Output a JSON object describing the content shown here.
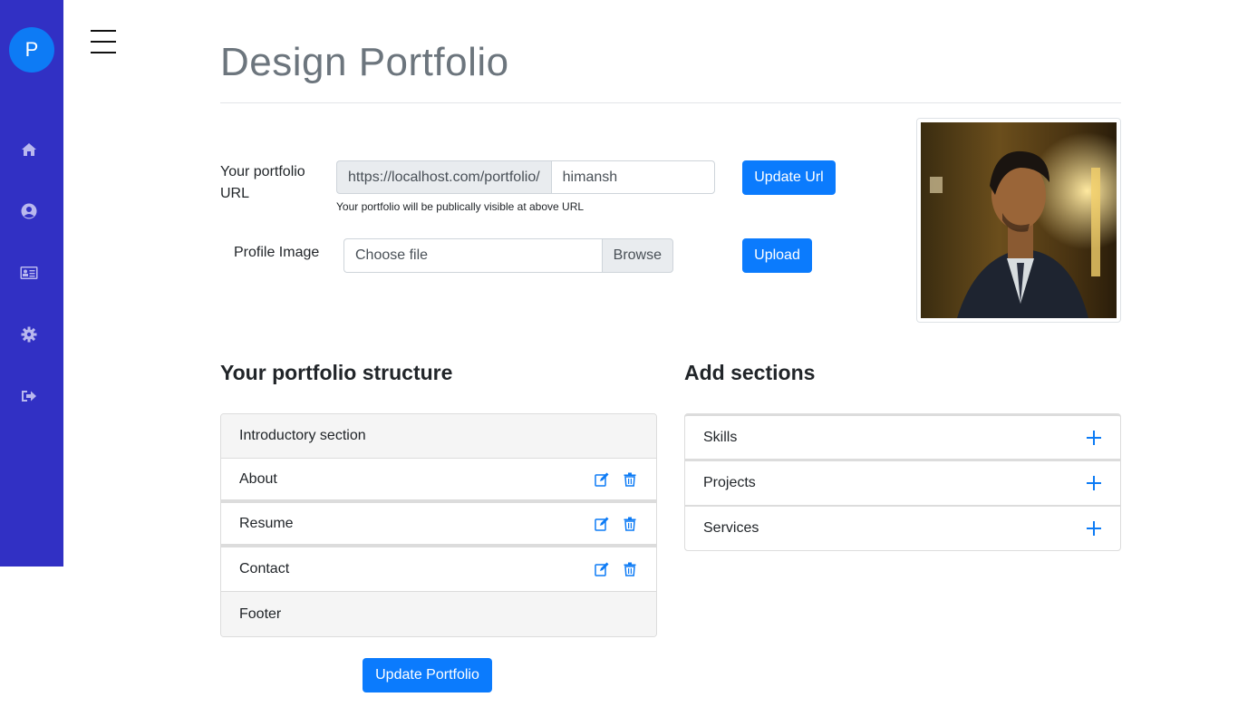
{
  "sidebar": {
    "avatar_letter": "P",
    "icons": [
      "home-icon",
      "user-circle-icon",
      "id-card-icon",
      "gear-icon",
      "sign-out-icon"
    ],
    "bg_color": "#3130c4"
  },
  "page": {
    "title": "Design Portfolio"
  },
  "url_form": {
    "label": "Your portfolio URL",
    "prefix": "https://localhost.com/portfolio/",
    "value": "himansh",
    "help": "Your portfolio will be publically visible at above URL",
    "button": "Update Url"
  },
  "image_form": {
    "label": "Profile Image",
    "placeholder": "Choose file",
    "browse": "Browse",
    "button": "Upload"
  },
  "structure": {
    "title": "Your portfolio structure",
    "items": [
      {
        "label": "Introductory section"
      },
      {
        "label": "About"
      },
      {
        "label": "Resume"
      },
      {
        "label": "Contact"
      },
      {
        "label": "Footer"
      }
    ],
    "update_button": "Update Portfolio"
  },
  "add_sections": {
    "title": "Add sections",
    "items": [
      {
        "label": "Skills"
      },
      {
        "label": "Projects"
      },
      {
        "label": "Services"
      }
    ]
  },
  "colors": {
    "primary": "#0b7bfd",
    "icon_blue": "#0d7bf5"
  }
}
